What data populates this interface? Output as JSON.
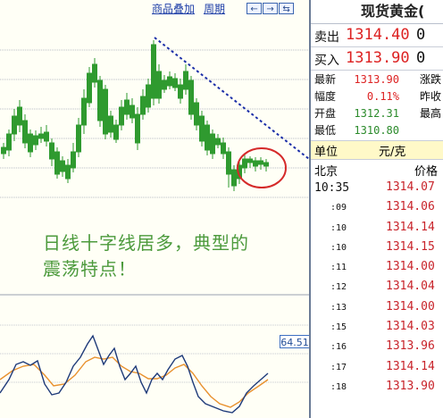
{
  "toolbar": {
    "overlay_label": "商品叠加",
    "period_label": "周期",
    "btn_left": "←",
    "btn_right": "→",
    "btn_expand": "⇆"
  },
  "annotation": {
    "line1": "日线十字线居多，典型的",
    "line2": "震荡特点！"
  },
  "oscillator": {
    "value": "64.51"
  },
  "quote": {
    "title": "现货黄金(",
    "sell": {
      "label": "卖出",
      "price": "1314.40",
      "volume": "0"
    },
    "buy": {
      "label": "买入",
      "price": "1313.90",
      "volume": "0"
    },
    "stats": [
      {
        "label": "最新",
        "value": "1313.90",
        "color": "#d22",
        "extra": "涨跌"
      },
      {
        "label": "幅度",
        "value": "0.11%",
        "color": "#d22",
        "extra": "昨收"
      },
      {
        "label": "开盘",
        "value": "1312.31",
        "color": "#2a8a2a",
        "extra": "最高"
      },
      {
        "label": "最低",
        "value": "1310.80",
        "color": "#2a8a2a",
        "extra": ""
      }
    ],
    "unit_label": "单位",
    "unit_value": "元/克",
    "market": "北京",
    "price_header": "价格",
    "ticks": [
      {
        "time": "10:35",
        "price": "1314.07",
        "full": true
      },
      {
        "time": ":09",
        "price": "1314.06",
        "full": false
      },
      {
        "time": ":10",
        "price": "1314.14",
        "full": false
      },
      {
        "time": ":10",
        "price": "1314.15",
        "full": false
      },
      {
        "time": ":11",
        "price": "1314.00",
        "full": false
      },
      {
        "time": ":12",
        "price": "1314.04",
        "full": false
      },
      {
        "time": ":13",
        "price": "1314.00",
        "full": false
      },
      {
        "time": ":15",
        "price": "1314.03",
        "full": false
      },
      {
        "time": ":16",
        "price": "1313.96",
        "full": false
      },
      {
        "time": ":17",
        "price": "1314.14",
        "full": false
      },
      {
        "time": ":18",
        "price": "1313.90",
        "full": false
      }
    ]
  },
  "colors": {
    "up": "#d12a2a",
    "down": "#2f9a2f",
    "trendline": "#1b2ea8",
    "circle": "#d52a2a",
    "osc_k": "#1f3b7a",
    "osc_d": "#e8912e"
  }
}
